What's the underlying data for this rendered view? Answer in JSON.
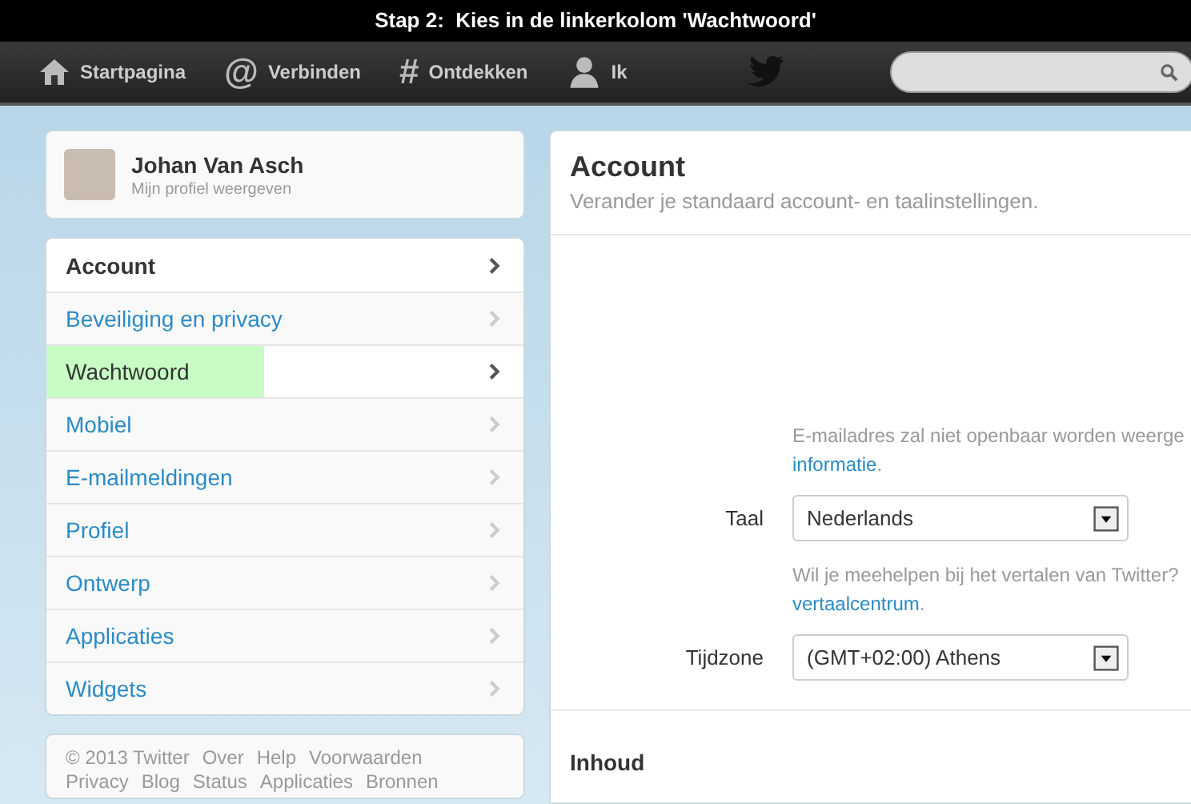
{
  "caption": "Stap 2:  Kies in de linkerkolom 'Wachtwoord'",
  "nav": [
    {
      "kind": "home",
      "label": "Startpagina"
    },
    {
      "kind": "glyph",
      "glyph": "@",
      "label": "Verbinden"
    },
    {
      "kind": "glyph",
      "glyph": "#",
      "label": "Ontdekken"
    },
    {
      "kind": "person",
      "label": "Ik"
    }
  ],
  "profile": {
    "name": "Johan Van Asch",
    "link": "Mijn profiel weergeven"
  },
  "menu": [
    {
      "label": "Account",
      "selected": true,
      "highlighted": false
    },
    {
      "label": "Beveiliging en privacy",
      "selected": false,
      "highlighted": false
    },
    {
      "label": "Wachtwoord",
      "selected": false,
      "highlighted": true
    },
    {
      "label": "Mobiel",
      "selected": false,
      "highlighted": false
    },
    {
      "label": "E-mailmeldingen",
      "selected": false,
      "highlighted": false
    },
    {
      "label": "Profiel",
      "selected": false,
      "highlighted": false
    },
    {
      "label": "Ontwerp",
      "selected": false,
      "highlighted": false
    },
    {
      "label": "Applicaties",
      "selected": false,
      "highlighted": false
    },
    {
      "label": "Widgets",
      "selected": false,
      "highlighted": false
    }
  ],
  "footer": [
    [
      "© 2013 Twitter",
      "Over",
      "Help",
      "Voorwaarden"
    ],
    [
      "Privacy",
      "Blog",
      "Status",
      "Applicaties",
      "Bronnen"
    ]
  ],
  "panel": {
    "title": "Account",
    "subtitle": "Verander je standaard account- en taalinstellingen.",
    "email_hint": {
      "text": "E-mailadres zal niet openbaar worden weerge",
      "link": "informatie",
      "after": "."
    },
    "fields": [
      {
        "label": "Taal",
        "value": "Nederlands",
        "hint": {
          "text": "Wil je meehelpen bij het vertalen van Twitter?",
          "link": "vertaalcentrum",
          "after": "."
        }
      },
      {
        "label": "Tijdzone",
        "value": "(GMT+02:00) Athens"
      }
    ],
    "section": "Inhoud"
  }
}
